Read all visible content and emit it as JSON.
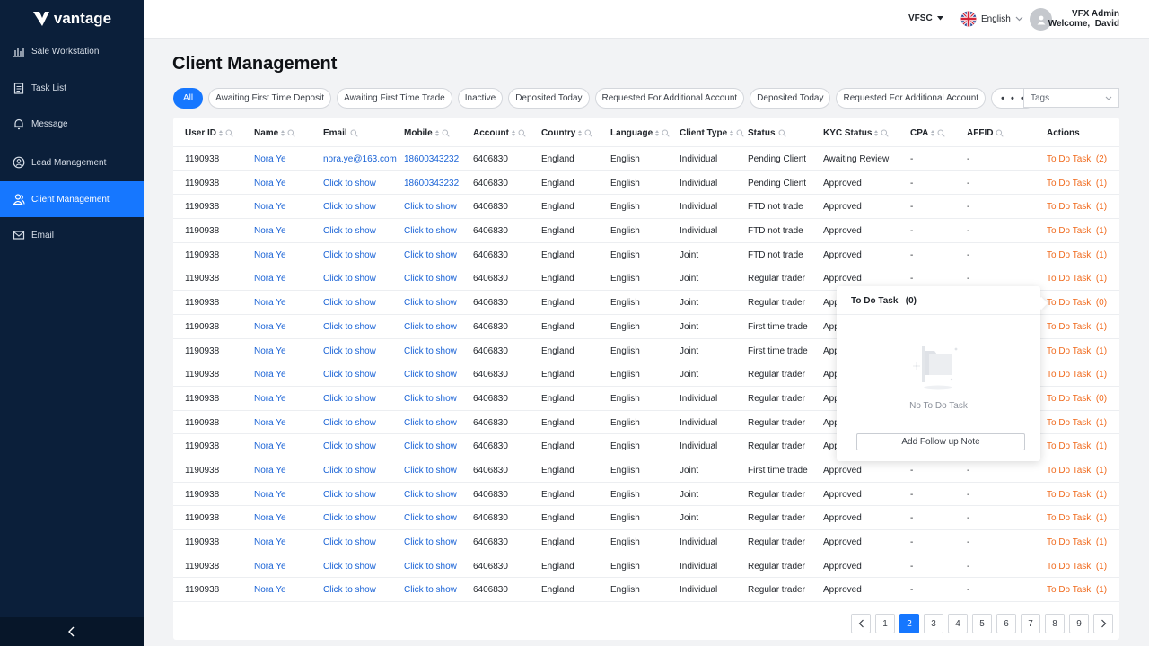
{
  "brand": {
    "name": "vantage"
  },
  "sidebar": {
    "items": [
      {
        "label": "Sale Workstation",
        "icon": "bar-chart-icon"
      },
      {
        "label": "Task List",
        "icon": "clipboard-icon"
      },
      {
        "label": "Message",
        "icon": "bell-icon"
      },
      {
        "label": "Lead Management",
        "icon": "user-circle-icon"
      },
      {
        "label": "Client Management",
        "icon": "users-icon",
        "active": true
      },
      {
        "label": "Email",
        "icon": "mail-icon"
      }
    ],
    "collapse_icon": "chevron-left-icon"
  },
  "header": {
    "entity": "VFSC",
    "language": "English",
    "user_name": "VFX Admin",
    "welcome": "Welcome,  David"
  },
  "page": {
    "title": "Client Management"
  },
  "filters": [
    "All",
    "Awaiting First Time Deposit",
    "Awaiting First Time Trade",
    "Inactive",
    "Deposited Today",
    "Requested For Additional Account",
    "Deposited Today",
    "Requested For Additional Account"
  ],
  "filters_more": "• • •",
  "tags_placeholder": "Tags",
  "table": {
    "columns": [
      "User ID",
      "Name",
      "Email",
      "Mobile",
      "Account",
      "Country",
      "Language",
      "Client Type",
      "Status",
      "KYC Status",
      "CPA",
      "AFFID",
      "Actions"
    ],
    "rows": [
      [
        "1190938",
        "Nora Ye",
        "nora.ye@163.com",
        "18600343232",
        "6406830",
        "England",
        "English",
        "Individual",
        "Pending Client",
        "Awaiting Review",
        "-",
        "-",
        "To Do Task  (2)"
      ],
      [
        "1190938",
        "Nora Ye",
        "Click to show",
        "18600343232",
        "6406830",
        "England",
        "English",
        "Individual",
        "Pending Client",
        "Approved",
        "-",
        "-",
        "To Do Task  (1)"
      ],
      [
        "1190938",
        "Nora Ye",
        "Click to show",
        "Click to show",
        "6406830",
        "England",
        "English",
        "Individual",
        "FTD not trade",
        "Approved",
        "-",
        "-",
        "To Do Task  (1)"
      ],
      [
        "1190938",
        "Nora Ye",
        "Click to show",
        "Click to show",
        "6406830",
        "England",
        "English",
        "Individual",
        "FTD not trade",
        "Approved",
        "-",
        "-",
        "To Do Task  (1)"
      ],
      [
        "1190938",
        "Nora Ye",
        "Click to show",
        "Click to show",
        "6406830",
        "England",
        "English",
        "Joint",
        "FTD not trade",
        "Approved",
        "-",
        "-",
        "To Do Task  (1)"
      ],
      [
        "1190938",
        "Nora Ye",
        "Click to show",
        "Click to show",
        "6406830",
        "England",
        "English",
        "Joint",
        "Regular trader",
        "Approved",
        "-",
        "-",
        "To Do Task  (1)"
      ],
      [
        "1190938",
        "Nora Ye",
        "Click to show",
        "Click to show",
        "6406830",
        "England",
        "English",
        "Joint",
        "Regular trader",
        "App",
        "",
        "",
        "To Do Task  (0)"
      ],
      [
        "1190938",
        "Nora Ye",
        "Click to show",
        "Click to show",
        "6406830",
        "England",
        "English",
        "Joint",
        "First time trade",
        "App",
        "",
        "",
        "To Do Task  (1)"
      ],
      [
        "1190938",
        "Nora Ye",
        "Click to show",
        "Click to show",
        "6406830",
        "England",
        "English",
        "Joint",
        "First time trade",
        "App",
        "",
        "",
        "To Do Task  (1)"
      ],
      [
        "1190938",
        "Nora Ye",
        "Click to show",
        "Click to show",
        "6406830",
        "England",
        "English",
        "Joint",
        "Regular trader",
        "App",
        "",
        "",
        "To Do Task  (1)"
      ],
      [
        "1190938",
        "Nora Ye",
        "Click to show",
        "Click to show",
        "6406830",
        "England",
        "English",
        "Individual",
        "Regular trader",
        "App",
        "",
        "",
        "To Do Task  (0)"
      ],
      [
        "1190938",
        "Nora Ye",
        "Click to show",
        "Click to show",
        "6406830",
        "England",
        "English",
        "Individual",
        "Regular trader",
        "App",
        "",
        "",
        "To Do Task  (1)"
      ],
      [
        "1190938",
        "Nora Ye",
        "Click to show",
        "Click to show",
        "6406830",
        "England",
        "English",
        "Individual",
        "Regular trader",
        "App",
        "",
        "",
        "To Do Task  (1)"
      ],
      [
        "1190938",
        "Nora Ye",
        "Click to show",
        "Click to show",
        "6406830",
        "England",
        "English",
        "Joint",
        "First time trade",
        "Approved",
        "-",
        "-",
        "To Do Task  (1)"
      ],
      [
        "1190938",
        "Nora Ye",
        "Click to show",
        "Click to show",
        "6406830",
        "England",
        "English",
        "Joint",
        "Regular trader",
        "Approved",
        "-",
        "-",
        "To Do Task  (1)"
      ],
      [
        "1190938",
        "Nora Ye",
        "Click to show",
        "Click to show",
        "6406830",
        "England",
        "English",
        "Joint",
        "Regular trader",
        "Approved",
        "-",
        "-",
        "To Do Task  (1)"
      ],
      [
        "1190938",
        "Nora Ye",
        "Click to show",
        "Click to show",
        "6406830",
        "England",
        "English",
        "Individual",
        "Regular trader",
        "Approved",
        "-",
        "-",
        "To Do Task  (1)"
      ],
      [
        "1190938",
        "Nora Ye",
        "Click to show",
        "Click to show",
        "6406830",
        "England",
        "English",
        "Individual",
        "Regular trader",
        "Approved",
        "-",
        "-",
        "To Do Task  (1)"
      ],
      [
        "1190938",
        "Nora Ye",
        "Click to show",
        "Click to show",
        "6406830",
        "England",
        "English",
        "Individual",
        "Regular trader",
        "Approved",
        "-",
        "-",
        "To Do Task  (1)"
      ]
    ]
  },
  "popover": {
    "title": "To Do Task   (0)",
    "empty_text": "No To Do Task",
    "button": "Add Follow up Note"
  },
  "pagination": {
    "pages": [
      "1",
      "2",
      "3",
      "4",
      "5",
      "6",
      "7",
      "8",
      "9"
    ],
    "current": "2"
  },
  "colors": {
    "sidebar": "#0b1f3a",
    "accent": "#1677ff",
    "link": "#1a63d6",
    "task": "#f06a1d"
  }
}
